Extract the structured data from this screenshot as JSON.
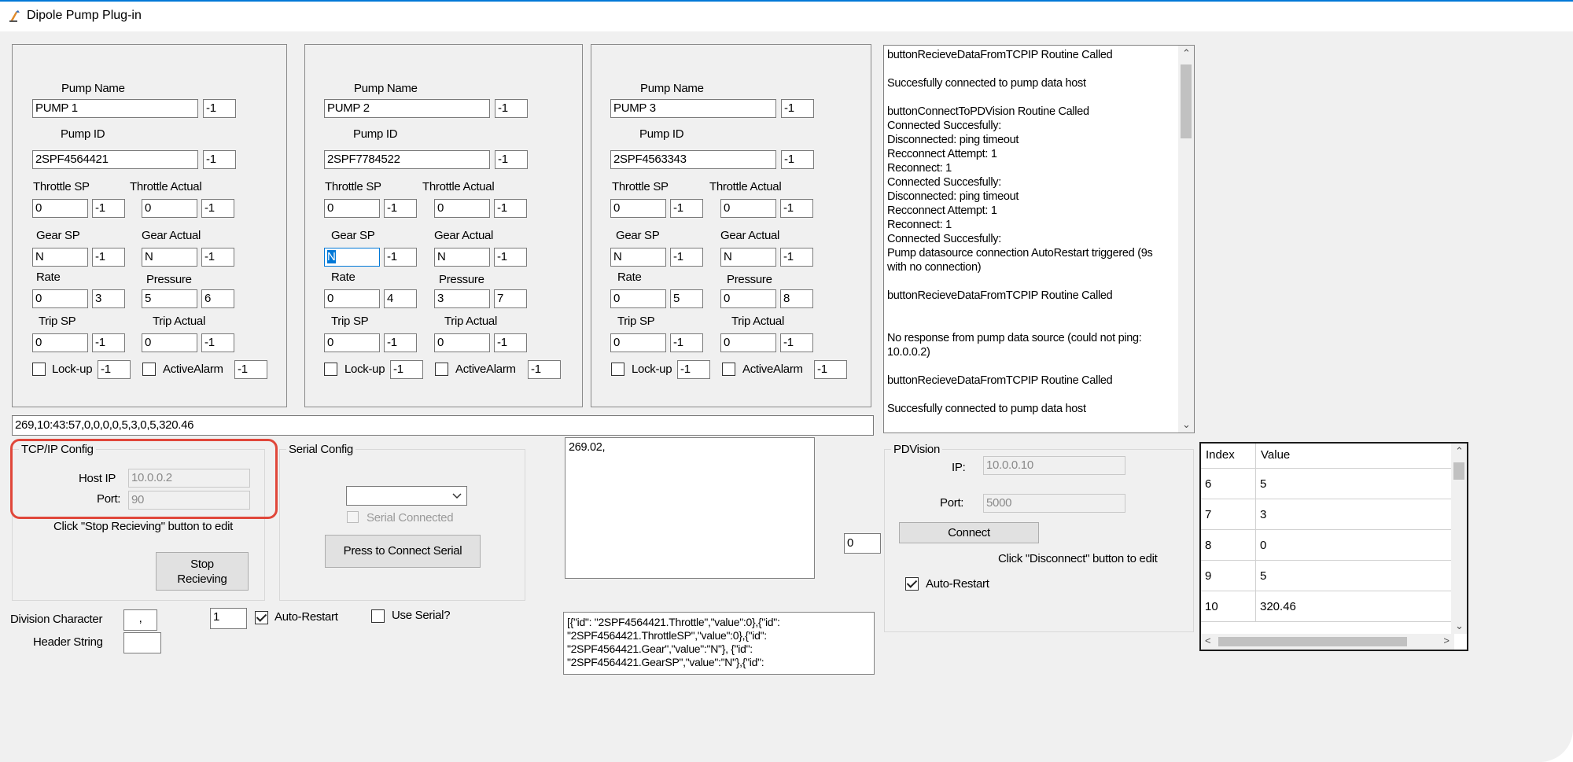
{
  "window": {
    "title": "Dipole Pump Plug-in"
  },
  "labels": {
    "pump_name": "Pump Name",
    "pump_id": "Pump ID",
    "throttle_sp": "Throttle SP",
    "throttle_actual": "Throttle Actual",
    "gear_sp": "Gear SP",
    "gear_actual": "Gear Actual",
    "rate": "Rate",
    "pressure": "Pressure",
    "trip_sp": "Trip SP",
    "trip_actual": "Trip Actual",
    "lockup": "Lock-up",
    "active_alarm": "ActiveAlarm"
  },
  "pumps": [
    {
      "name": "PUMP 1",
      "name_idx": "-1",
      "id": "2SPF4564421",
      "id_idx": "-1",
      "throttle_sp": "0",
      "throttle_sp_idx": "-1",
      "throttle_actual": "0",
      "throttle_actual_idx": "-1",
      "gear_sp": "N",
      "gear_sp_idx": "-1",
      "gear_actual": "N",
      "gear_actual_idx": "-1",
      "rate": "0",
      "rate_idx": "3",
      "pressure": "5",
      "pressure_idx": "6",
      "trip_sp": "0",
      "trip_sp_idx": "-1",
      "trip_actual": "0",
      "trip_actual_idx": "-1",
      "lockup_idx": "-1",
      "alarm_idx": "-1"
    },
    {
      "name": "PUMP 2",
      "name_idx": "-1",
      "id": "2SPF7784522",
      "id_idx": "-1",
      "throttle_sp": "0",
      "throttle_sp_idx": "-1",
      "throttle_actual": "0",
      "throttle_actual_idx": "-1",
      "gear_sp": "N",
      "gear_sp_idx": "-1",
      "gear_actual": "N",
      "gear_actual_idx": "-1",
      "rate": "0",
      "rate_idx": "4",
      "pressure": "3",
      "pressure_idx": "7",
      "trip_sp": "0",
      "trip_sp_idx": "-1",
      "trip_actual": "0",
      "trip_actual_idx": "-1",
      "lockup_idx": "-1",
      "alarm_idx": "-1"
    },
    {
      "name": "PUMP 3",
      "name_idx": "-1",
      "id": "2SPF4563343",
      "id_idx": "-1",
      "throttle_sp": "0",
      "throttle_sp_idx": "-1",
      "throttle_actual": "0",
      "throttle_actual_idx": "-1",
      "gear_sp": "N",
      "gear_sp_idx": "-1",
      "gear_actual": "N",
      "gear_actual_idx": "-1",
      "rate": "0",
      "rate_idx": "5",
      "pressure": "0",
      "pressure_idx": "8",
      "trip_sp": "0",
      "trip_sp_idx": "-1",
      "trip_actual": "0",
      "trip_actual_idx": "-1",
      "lockup_idx": "-1",
      "alarm_idx": "-1"
    }
  ],
  "log": [
    "buttonRecieveDataFromTCPIP Routine Called",
    "",
    "Succesfully connected to pump data host",
    "",
    "buttonConnectToPDVision Routine Called",
    "Connected Succesfully:",
    "Disconnected: ping timeout",
    "Recconnect Attempt: 1",
    "Reconnect: 1",
    "Connected Succesfully:",
    "Disconnected: ping timeout",
    "Recconnect Attempt: 1",
    "Reconnect: 1",
    "Connected Succesfully:",
    "Pump datasource connection AutoRestart triggered (9s",
    "with no connection)",
    "",
    "buttonRecieveDataFromTCPIP Routine Called",
    "",
    "",
    "No response from pump data source (could not ping:",
    "10.0.0.2)",
    "",
    "buttonRecieveDataFromTCPIP Routine Called",
    "",
    "Succesfully connected to pump data host"
  ],
  "raw_data": "269,10:43:57,0,0,0,0,5,3,0,5,320.46",
  "tcpip": {
    "title": "TCP/IP Config",
    "host_label": "Host IP",
    "host_value": "10.0.0.2",
    "port_label": "Port:",
    "port_value": "90",
    "hint": "Click \"Stop Recieving\" button to edit",
    "stop_line1": "Stop",
    "stop_line2": "Recieving"
  },
  "serial": {
    "title": "Serial Config",
    "connected_label": "Serial Connected",
    "connect_button": "Press to Connect Serial"
  },
  "received_text": "269.02,",
  "counter_value": "0",
  "pdvision": {
    "title": "PDVision",
    "ip_label": "IP:",
    "ip_value": "10.0.0.10",
    "port_label": "Port:",
    "port_value": "5000",
    "connect_button": "Connect",
    "hint": "Click \"Disconnect\" button to edit",
    "auto_restart_label": "Auto-Restart"
  },
  "grid": {
    "headers": [
      "Index",
      "Value"
    ],
    "rows": [
      [
        "6",
        "5"
      ],
      [
        "7",
        "3"
      ],
      [
        "8",
        "0"
      ],
      [
        "9",
        "5"
      ],
      [
        "10",
        "320.46"
      ]
    ]
  },
  "bottom": {
    "division_label": "Division Character",
    "division_value": ",",
    "header_label": "Header String",
    "header_value": "",
    "count_value": "1",
    "auto_restart_label": "Auto-Restart",
    "use_serial_label": "Use Serial?"
  },
  "json_output": [
    "[{\"id\": \"2SPF4564421.Throttle\",\"value\":0},{\"id\":",
    "\"2SPF4564421.ThrottleSP\",\"value\":0},{\"id\":",
    "\"2SPF4564421.Gear\",\"value\":\"N\"}, {\"id\":",
    "\"2SPF4564421.GearSP\",\"value\":\"N\"},{\"id\":"
  ]
}
